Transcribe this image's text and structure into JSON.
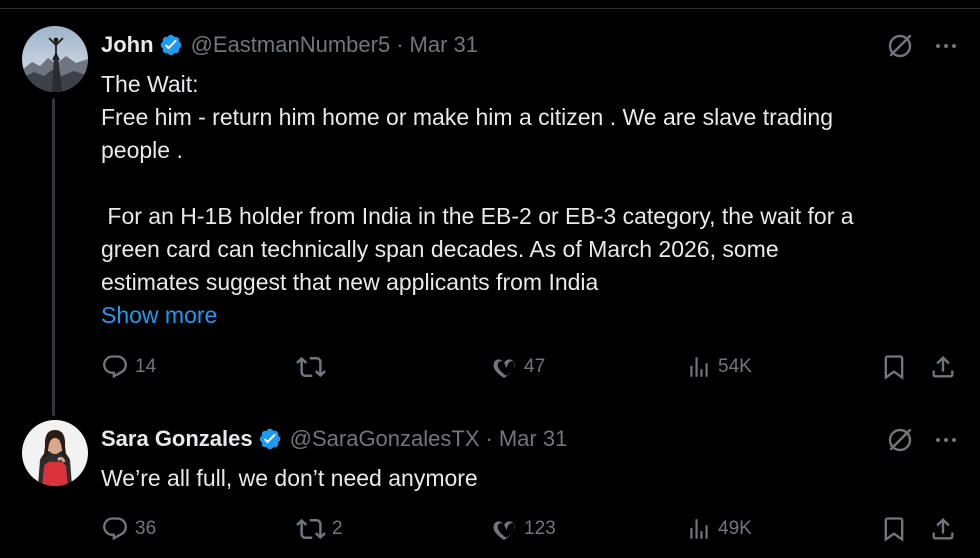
{
  "tweets": [
    {
      "name": "John",
      "handle": "@EastmanNumber5",
      "separator": "·",
      "date": "Mar 31",
      "verified": true,
      "body_lines": [
        "The Wait:",
        "Free him - return him home or make him a citizen . We are slave trading",
        "people .",
        "",
        " For an H-1B holder from India in the EB-2 or EB-3 category, the wait for a",
        "green card can technically span decades. As of March 2026, some",
        "estimates suggest that new applicants from India"
      ],
      "show_more": "Show more",
      "replies": "14",
      "reposts": "",
      "likes": "47",
      "views": "54K"
    },
    {
      "name": "Sara Gonzales",
      "handle": "@SaraGonzalesTX",
      "separator": "·",
      "date": "Mar 31",
      "verified": true,
      "body_lines": [
        "We’re all full, we don’t need anymore"
      ],
      "replies": "36",
      "reposts": "2",
      "likes": "123",
      "views": "49K"
    }
  ],
  "icons": {
    "verified": "verified-badge-icon",
    "grok": "grok-icon",
    "more": "more-icon",
    "reply": "reply-icon",
    "repost": "repost-icon",
    "like": "like-icon",
    "views": "views-icon",
    "bookmark": "bookmark-icon",
    "share": "share-icon"
  },
  "colors": {
    "background": "#000000",
    "text": "#e7e9ea",
    "muted": "#71767b",
    "accent": "#1d9bf0",
    "thread_line": "#333639"
  }
}
